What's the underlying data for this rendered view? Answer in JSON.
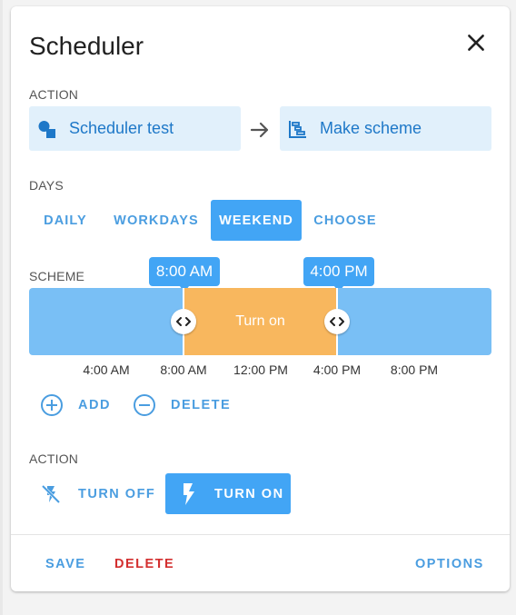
{
  "dialog": {
    "title": "Scheduler"
  },
  "action_section": {
    "label": "ACTION",
    "entity_label": "Scheduler test",
    "service_label": "Make scheme"
  },
  "days_section": {
    "label": "DAYS",
    "tabs": [
      {
        "label": "DAILY",
        "active": false
      },
      {
        "label": "WORKDAYS",
        "active": false
      },
      {
        "label": "WEEKEND",
        "active": true
      },
      {
        "label": "CHOOSE",
        "active": false
      }
    ]
  },
  "scheme_section": {
    "label": "SCHEME",
    "start_time": "8:00 AM",
    "end_time": "4:00 PM",
    "segment_label": "Turn on",
    "segment_start_fraction": 0.3333,
    "segment_end_fraction": 0.6667,
    "ticks": [
      "4:00 AM",
      "8:00 AM",
      "12:00 PM",
      "4:00 PM",
      "8:00 PM"
    ],
    "add_label": "ADD",
    "delete_label": "DELETE"
  },
  "action2_section": {
    "label": "ACTION",
    "turn_off_label": "TURN OFF",
    "turn_on_label": "TURN ON",
    "selected": "TURN ON"
  },
  "footer": {
    "save_label": "SAVE",
    "delete_label": "DELETE",
    "options_label": "OPTIONS"
  },
  "colors": {
    "accent": "#42a5f5",
    "timeline_bg": "#79bff5",
    "segment": "#f8b75e",
    "danger": "#d32f2f"
  }
}
